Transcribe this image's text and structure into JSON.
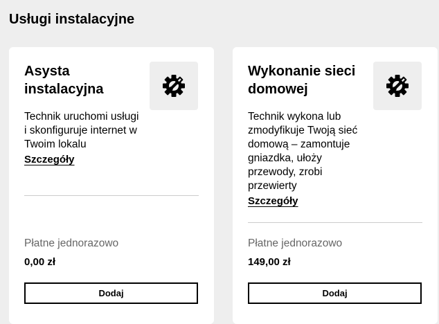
{
  "section": {
    "title": "Usługi instalacyjne"
  },
  "cards": [
    {
      "title": "Asysta instalacyjna",
      "icon": "gear-wrench-icon",
      "description": "Technik uruchomi usługi i skonfiguruje internet w Twoim lokalu",
      "details_label": "Szczegóły",
      "price_label": "Płatne jednorazowo",
      "price": "0,00 zł",
      "button_label": "Dodaj"
    },
    {
      "title": "Wykonanie sieci domowej",
      "icon": "gear-wrench-icon",
      "description": "Technik wykona lub zmodyfikuje Twoją sieć domową – zamontuje gniazdka, ułoży przewody, zrobi przewierty",
      "details_label": "Szczegóły",
      "price_label": "Płatne jednorazowo",
      "price": "149,00 zł",
      "button_label": "Dodaj"
    }
  ]
}
